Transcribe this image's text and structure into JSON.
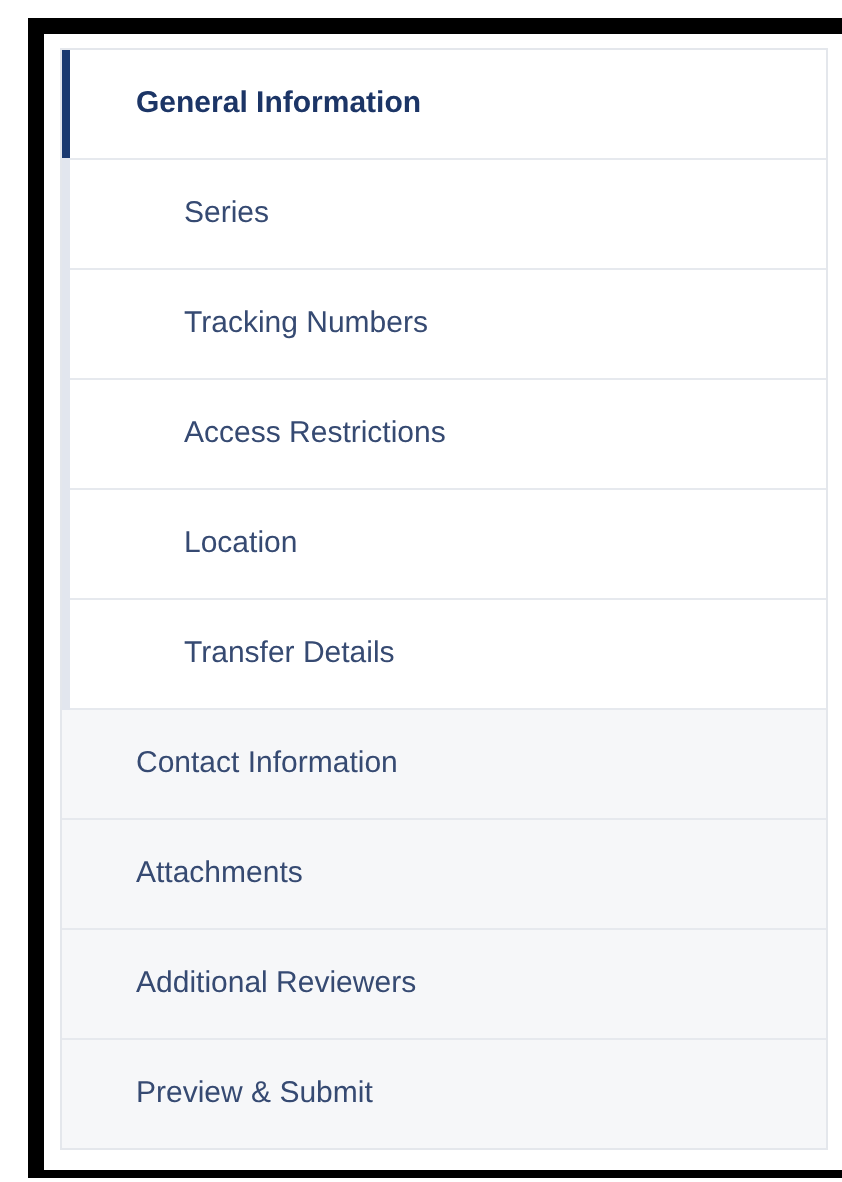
{
  "nav": {
    "items": [
      {
        "label": "General Information",
        "selected": true,
        "expanded": true,
        "children": [
          {
            "label": "Series",
            "selected": false
          },
          {
            "label": "Tracking Numbers",
            "selected": false
          },
          {
            "label": "Access Restrictions",
            "selected": false
          },
          {
            "label": "Location",
            "selected": false
          },
          {
            "label": "Transfer Details",
            "selected": false
          }
        ]
      },
      {
        "label": "Contact Information",
        "selected": false,
        "expanded": false
      },
      {
        "label": "Attachments",
        "selected": false,
        "expanded": false
      },
      {
        "label": "Additional Reviewers",
        "selected": false,
        "expanded": false
      },
      {
        "label": "Preview & Submit",
        "selected": false,
        "expanded": false
      }
    ]
  }
}
